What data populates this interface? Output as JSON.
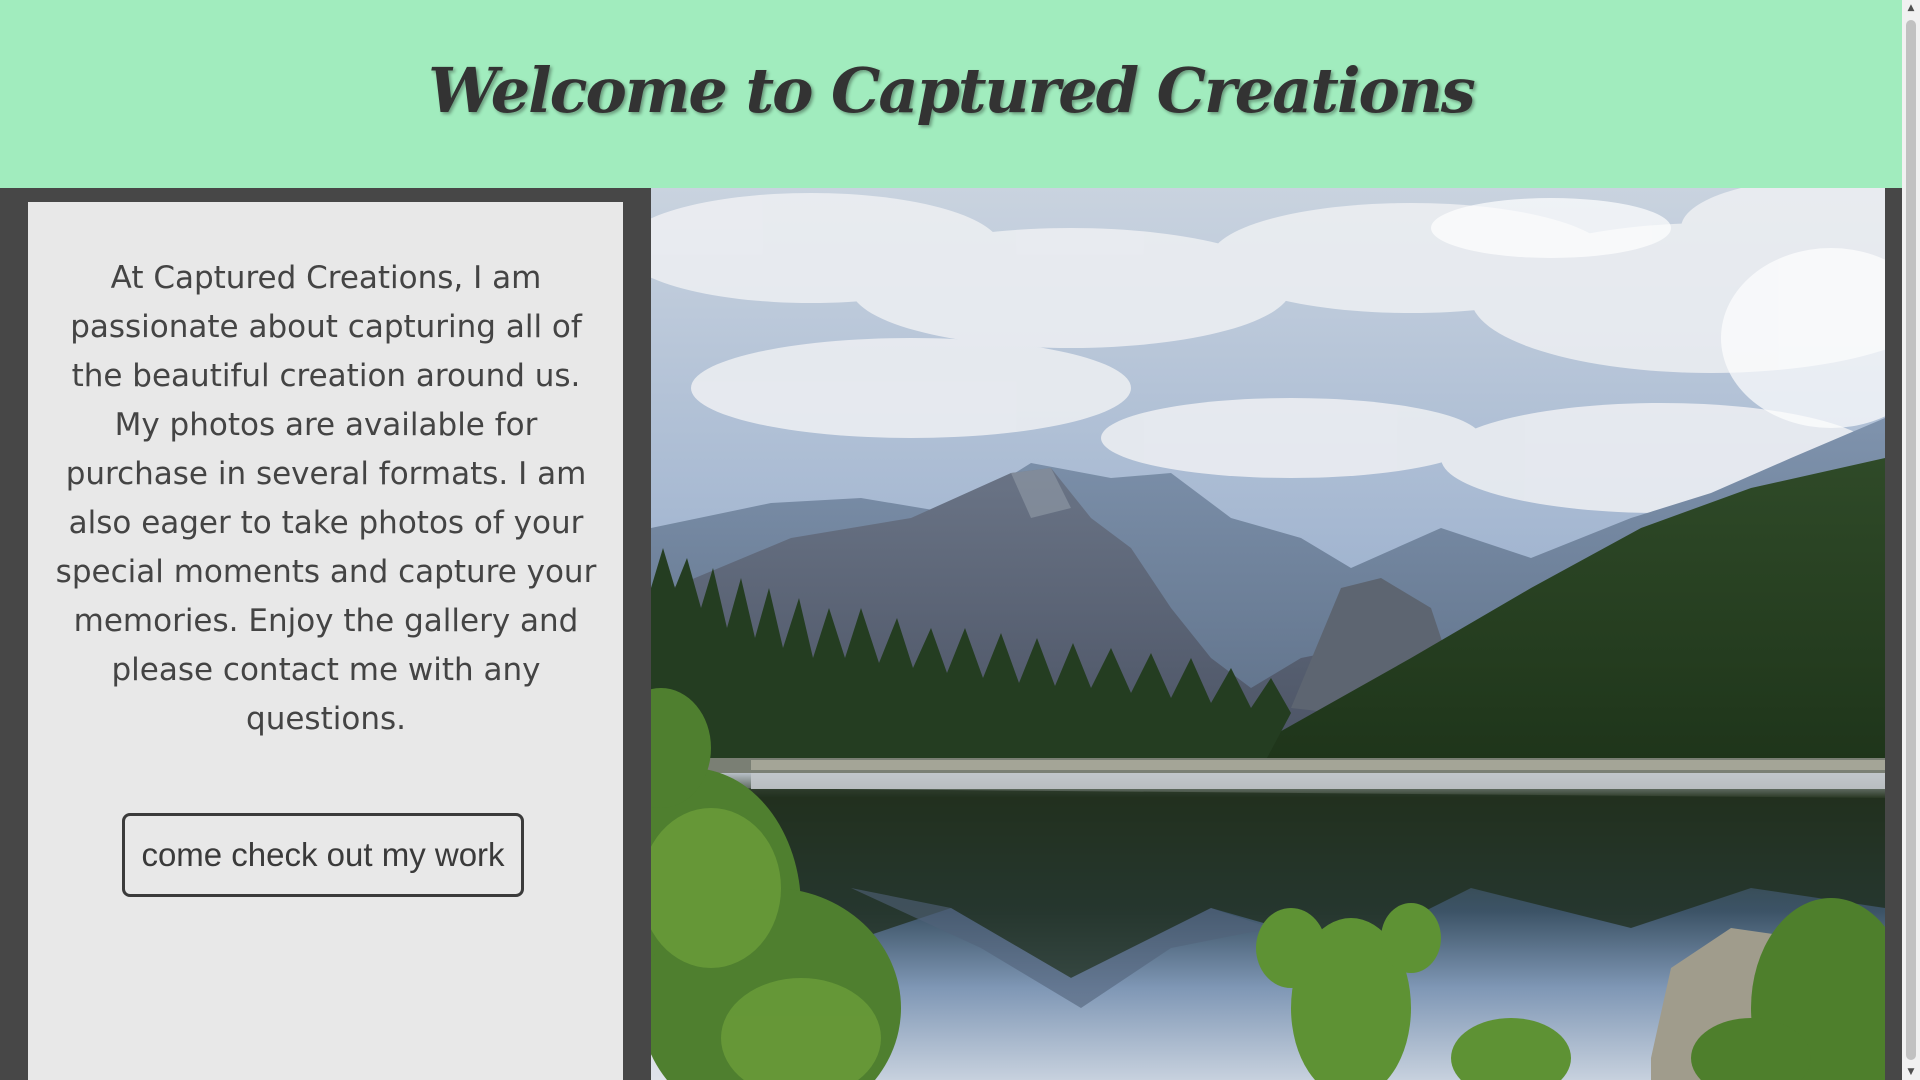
{
  "header": {
    "title": "Welcome to Captured Creations"
  },
  "intro": {
    "text": "At Captured Creations, I am passionate about capturing all of the beautiful creation around us. My photos are available for purchase in several formats. I am also eager to take photos of your special moments and capture your memories. Enjoy the gallery and please contact me with any questions.",
    "button_label": "come check out my work"
  },
  "hero": {
    "icon": "landscape-photo"
  },
  "colors": {
    "header_bg": "#a1ecbe",
    "page_bg": "#474747",
    "card_bg": "#e8e8e8",
    "text": "#444444"
  },
  "scrollbar": {
    "up_icon": "▲",
    "down_icon": "▼"
  }
}
